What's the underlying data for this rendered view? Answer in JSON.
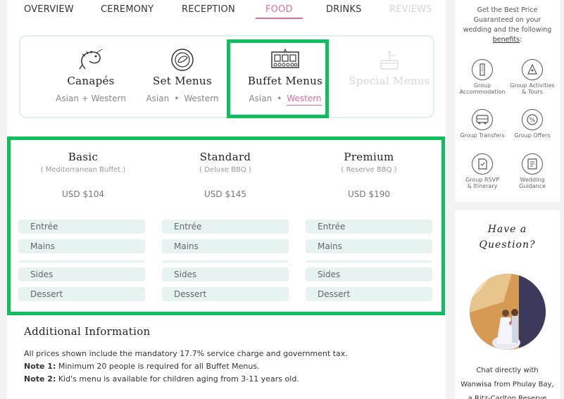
{
  "nav": {
    "tabs": [
      {
        "label": "OVERVIEW",
        "state": "normal"
      },
      {
        "label": "CEREMONY",
        "state": "normal"
      },
      {
        "label": "RECEPTION",
        "state": "normal"
      },
      {
        "label": "FOOD",
        "state": "active"
      },
      {
        "label": "DRINKS",
        "state": "normal"
      },
      {
        "label": "REVIEWS",
        "state": "disabled"
      }
    ]
  },
  "menu_types": [
    {
      "title": "Canapés",
      "icon": "shrimp-icon",
      "sub": "Asian + Western"
    },
    {
      "title": "Set Menus",
      "icon": "plate-icon",
      "sub_a": "Asian",
      "sub_b": "Western"
    },
    {
      "title": "Buffet Menus",
      "icon": "buffet-tray-icon",
      "sub_a": "Asian",
      "sub_b": "Western",
      "selected": "Western"
    },
    {
      "title": "Special Menus",
      "icon": "cake-icon",
      "disabled": true
    }
  ],
  "packages": [
    {
      "name": "Basic",
      "desc": "( Mediterranean Buffet )",
      "price": "USD $104"
    },
    {
      "name": "Standard",
      "desc": "( Deluxe BBQ )",
      "price": "USD $145"
    },
    {
      "name": "Premium",
      "desc": "( Reserve BBQ )",
      "price": "USD $190"
    }
  ],
  "courses": [
    "Entrée",
    "Mains",
    "Sides",
    "Dessert"
  ],
  "additional": {
    "title": "Additional Information",
    "line1": "All prices shown include the mandatory 17.7% service charge and government tax.",
    "note1_label": "Note 1:",
    "note1_text": " Minimum 20 people is required for all Buffet Menus.",
    "note2_label": "Note 2:",
    "note2_text": " Kid's menu is available for children aging from 3-11 years old."
  },
  "sidebar": {
    "intro_lines": [
      "Get the Best Price",
      "Guaranteed on your",
      "wedding and the following"
    ],
    "intro_link": "benefits",
    "intro_end": ":",
    "benefits": [
      {
        "label_1": "Group",
        "label_2": "Accommodation",
        "icon": "accommodation-icon"
      },
      {
        "label_1": "Group Activities",
        "label_2": "& Tours",
        "icon": "activities-icon"
      },
      {
        "label_1": "Group Transfers",
        "label_2": "",
        "icon": "bus-icon"
      },
      {
        "label_1": "Group Offers",
        "label_2": "",
        "icon": "percent-icon"
      },
      {
        "label_1": "Group RSVP",
        "label_2": "& Itinerary",
        "icon": "rsvp-icon"
      },
      {
        "label_1": "Wedding",
        "label_2": "Guidance",
        "icon": "guidance-icon"
      }
    ],
    "question_1": "Have a",
    "question_2": "Question?",
    "chat_1": "Chat directly with",
    "chat_2": "Wanwisa from Phulay Bay,",
    "chat_3": "a Ritz-Carlton Reserve"
  },
  "colors": {
    "accent": "#e06a9d",
    "highlight": "#0fbf5e",
    "row_bg": "#e6f3f1"
  }
}
